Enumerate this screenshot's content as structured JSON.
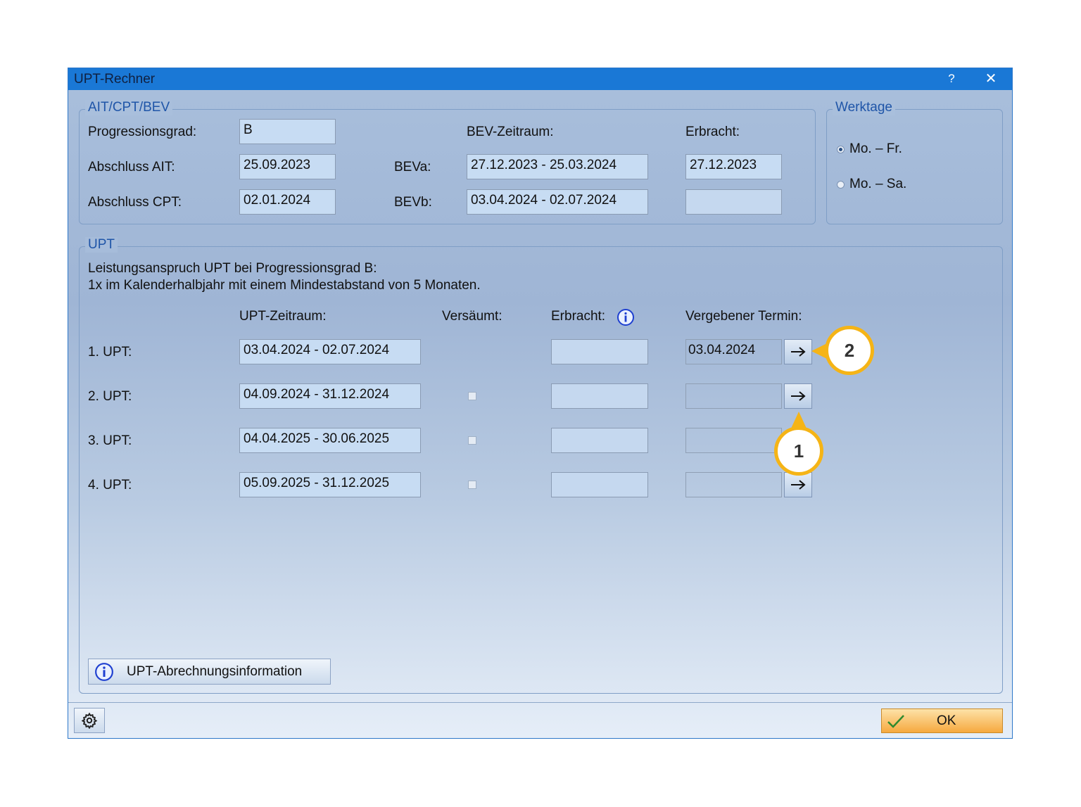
{
  "window": {
    "title": "UPT-Rechner",
    "help_label": "?",
    "close_label": "✕"
  },
  "ait_group": {
    "legend": "AIT/CPT/BEV",
    "progressionsgrad_label": "Progressionsgrad:",
    "progressionsgrad_value": "B",
    "abschluss_ait_label": "Abschluss AIT:",
    "abschluss_ait_value": "25.09.2023",
    "abschluss_cpt_label": "Abschluss CPT:",
    "abschluss_cpt_value": "02.01.2024",
    "bev_zeitraum_header": "BEV-Zeitraum:",
    "erbracht_header": "Erbracht:",
    "beva_label": "BEVa:",
    "beva_value": "27.12.2023 - 25.03.2024",
    "beva_erbracht": "27.12.2023",
    "bevb_label": "BEVb:",
    "bevb_value": "03.04.2024 - 02.07.2024",
    "bevb_erbracht": ""
  },
  "werktage": {
    "legend": "Werktage",
    "options": [
      {
        "label": "Mo. – Fr.",
        "selected": true
      },
      {
        "label": "Mo. – Sa.",
        "selected": false
      }
    ]
  },
  "upt_group": {
    "legend": "UPT",
    "info_line1": "Leistungsanspruch UPT bei Progressionsgrad B:",
    "info_line2": "1x im Kalenderhalbjahr mit einem Mindestabstand von 5 Monaten.",
    "headers": {
      "zeitraum": "UPT-Zeitraum:",
      "versaeumt": "Versäumt:",
      "erbracht": "Erbracht:",
      "termin": "Vergebener Termin:"
    },
    "rows": [
      {
        "label": "1. UPT:",
        "zeitraum": "03.04.2024 - 02.07.2024",
        "versaeumt": null,
        "erbracht": "",
        "termin": "03.04.2024"
      },
      {
        "label": "2. UPT:",
        "zeitraum": "04.09.2024 - 31.12.2024",
        "versaeumt": false,
        "erbracht": "",
        "termin": ""
      },
      {
        "label": "3. UPT:",
        "zeitraum": "04.04.2025 - 30.06.2025",
        "versaeumt": false,
        "erbracht": "",
        "termin": ""
      },
      {
        "label": "4. UPT:",
        "zeitraum": "05.09.2025 - 31.12.2025",
        "versaeumt": false,
        "erbracht": "",
        "termin": ""
      }
    ],
    "abrechnung_button": "UPT-Abrechnungsinformation"
  },
  "footer": {
    "ok_label": "OK"
  },
  "callouts": [
    "1",
    "2"
  ],
  "colors": {
    "titlebar": "#1a78d6",
    "callout_ring": "#f5b416",
    "ok_button": "#f6a93f",
    "info_icon": "#1e3fd0"
  }
}
